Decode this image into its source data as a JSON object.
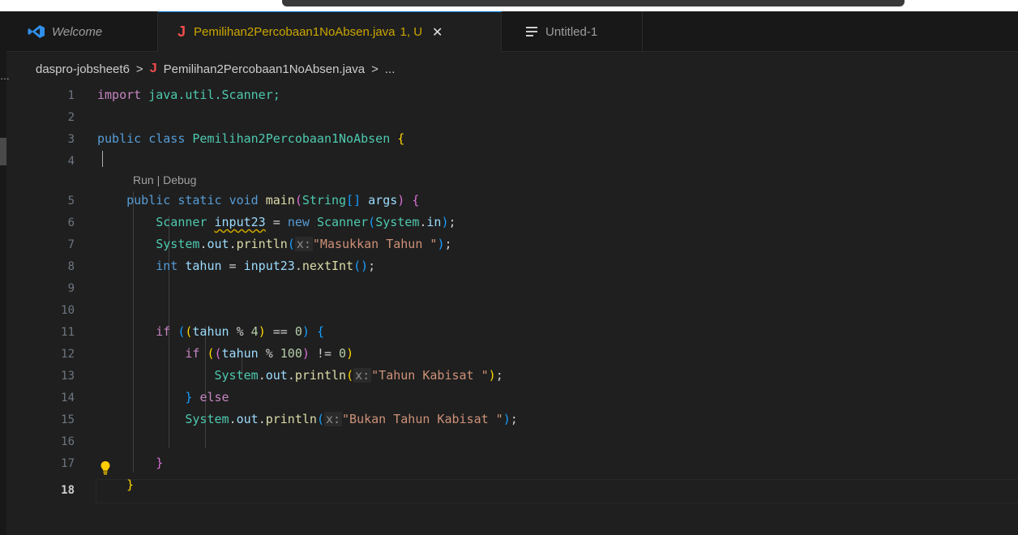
{
  "tabs": [
    {
      "label": "Welcome",
      "icon": "vscode-icon"
    },
    {
      "label": "Pemilihan2Percobaan1NoAbsen.java",
      "status": "1, U",
      "icon": "java-icon"
    },
    {
      "label": "Untitled-1",
      "icon": "lines-icon"
    }
  ],
  "breadcrumb": {
    "folder": "daspro-jobsheet6",
    "file": "Pemilihan2Percobaan1NoAbsen.java",
    "tail": "...",
    "separator": ">"
  },
  "codelens": {
    "run": "Run",
    "divider": "|",
    "debug": "Debug"
  },
  "line_numbers": [
    "1",
    "2",
    "3",
    "4",
    "5",
    "6",
    "7",
    "8",
    "9",
    "10",
    "11",
    "12",
    "13",
    "14",
    "15",
    "16",
    "17",
    "18"
  ],
  "code": {
    "import_kw": "import",
    "import_path": "java.util.Scanner;",
    "public": "public",
    "class_kw": "class",
    "class_name": "Pemilihan2Percobaan1NoAbsen",
    "static": "static",
    "void": "void",
    "main": "main",
    "String": "String",
    "args": "args",
    "Scanner": "Scanner",
    "input_var": "input23",
    "new_kw": "new",
    "System": "System",
    "in": "in",
    "out": "out",
    "println": "println",
    "hint_x": "x:",
    "str_masukkan": "\"Masukkan Tahun \"",
    "int_kw": "int",
    "tahun": "tahun",
    "nextInt": "nextInt",
    "if_kw": "if",
    "num_4": "4",
    "num_0": "0",
    "num_100": "100",
    "str_kabisat": "\"Tahun Kabisat \"",
    "else_kw": "else",
    "str_bukan": "\"Bukan Tahun Kabisat \""
  },
  "colors": {
    "background": "#1f1f1f",
    "keyword": "#569cd6",
    "type": "#4ec9b0",
    "string": "#ce9178",
    "warning": "#cca700"
  }
}
